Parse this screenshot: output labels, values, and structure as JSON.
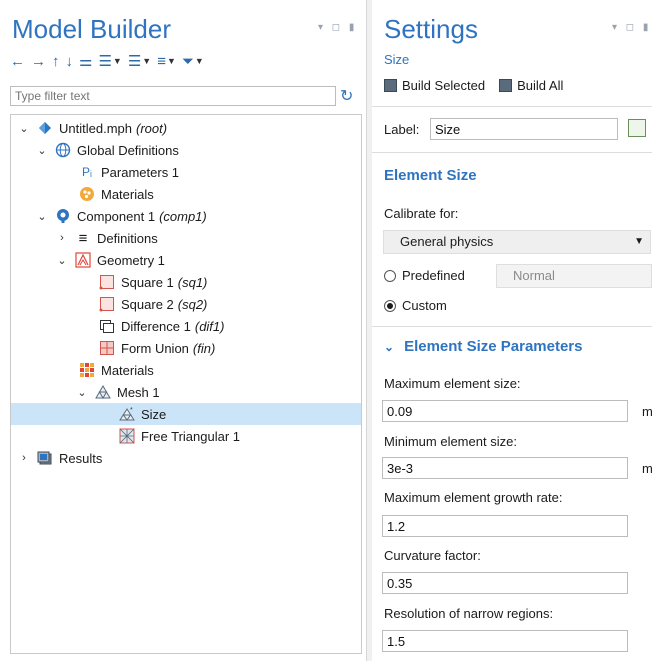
{
  "model_builder": {
    "title": "Model Builder",
    "filter_placeholder": "Type filter text",
    "tree": [
      {
        "label": "Untitled.mph",
        "tag": "(root)"
      },
      {
        "label": "Global Definitions",
        "tag": ""
      },
      {
        "label": "Parameters 1",
        "tag": ""
      },
      {
        "label": "Materials",
        "tag": ""
      },
      {
        "label": "Component 1",
        "tag": "(comp1)"
      },
      {
        "label": "Definitions",
        "tag": ""
      },
      {
        "label": "Geometry 1",
        "tag": ""
      },
      {
        "label": "Square 1",
        "tag": "(sq1)"
      },
      {
        "label": "Square 2",
        "tag": "(sq2)"
      },
      {
        "label": "Difference 1",
        "tag": "(dif1)"
      },
      {
        "label": "Form Union",
        "tag": "(fin)"
      },
      {
        "label": "Materials",
        "tag": ""
      },
      {
        "label": "Mesh 1",
        "tag": ""
      },
      {
        "label": "Size",
        "tag": ""
      },
      {
        "label": "Free Triangular 1",
        "tag": ""
      },
      {
        "label": "Results",
        "tag": ""
      }
    ]
  },
  "settings": {
    "title": "Settings",
    "subtitle": "Size",
    "build_selected": "Build Selected",
    "build_all": "Build All",
    "label_caption": "Label:",
    "label_value": "Size",
    "element_size_section": "Element Size",
    "calibrate_caption": "Calibrate for:",
    "calibrate_value": "General physics",
    "predefined_label": "Predefined",
    "predefined_value": "Normal",
    "custom_label": "Custom",
    "params_section": "Element Size Parameters",
    "max_size_caption": "Maximum element size:",
    "max_size_value": "0.09",
    "min_size_caption": "Minimum element size:",
    "min_size_value": "3e-3",
    "unit": "m",
    "growth_caption": "Maximum element growth rate:",
    "growth_value": "1.2",
    "curvature_caption": "Curvature factor:",
    "curvature_value": "0.35",
    "narrow_caption": "Resolution of narrow regions:",
    "narrow_value": "1.5"
  }
}
